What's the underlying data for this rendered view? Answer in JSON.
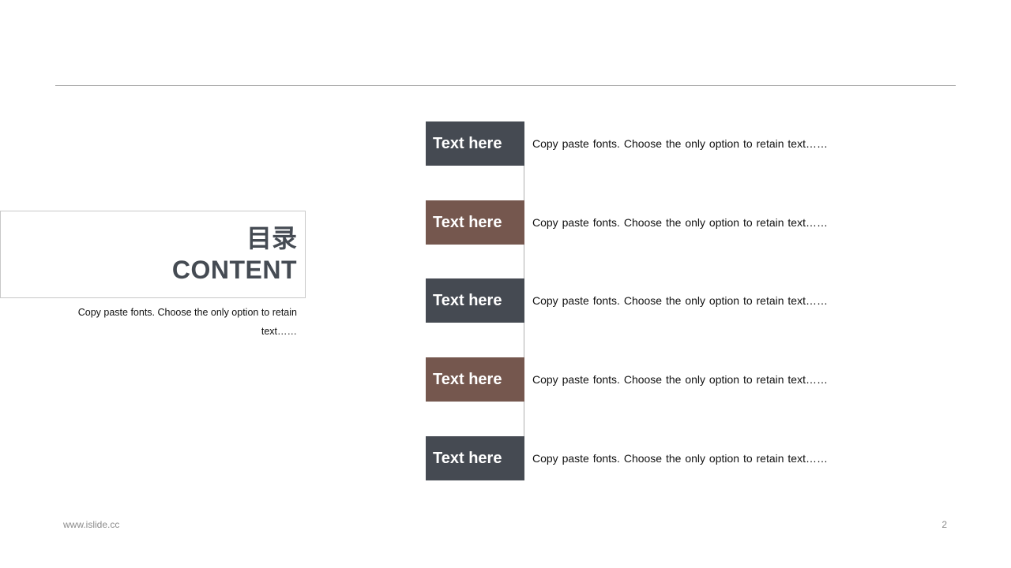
{
  "title": {
    "chinese": "目录",
    "english": "CONTENT",
    "description": "Copy paste fonts. Choose the only option to retain text……"
  },
  "items": [
    {
      "label": "Text here",
      "text": "Copy paste fonts. Choose the only option to retain text……",
      "color": "#454a52"
    },
    {
      "label": "Text here",
      "text": "Copy paste fonts. Choose the only option to retain text……",
      "color": "#75574e"
    },
    {
      "label": "Text here",
      "text": "Copy paste fonts. Choose the only option to retain text……",
      "color": "#454a52"
    },
    {
      "label": "Text here",
      "text": "Copy paste fonts. Choose the only option to retain text……",
      "color": "#75574e"
    },
    {
      "label": "Text here",
      "text": "Copy paste fonts. Choose the only option to retain text……",
      "color": "#454a52"
    }
  ],
  "footer": {
    "website": "www.islide.cc",
    "page_number": "2"
  },
  "colors": {
    "dark": "#454a52",
    "brown": "#75574e",
    "rule": "#a6a6a6"
  }
}
